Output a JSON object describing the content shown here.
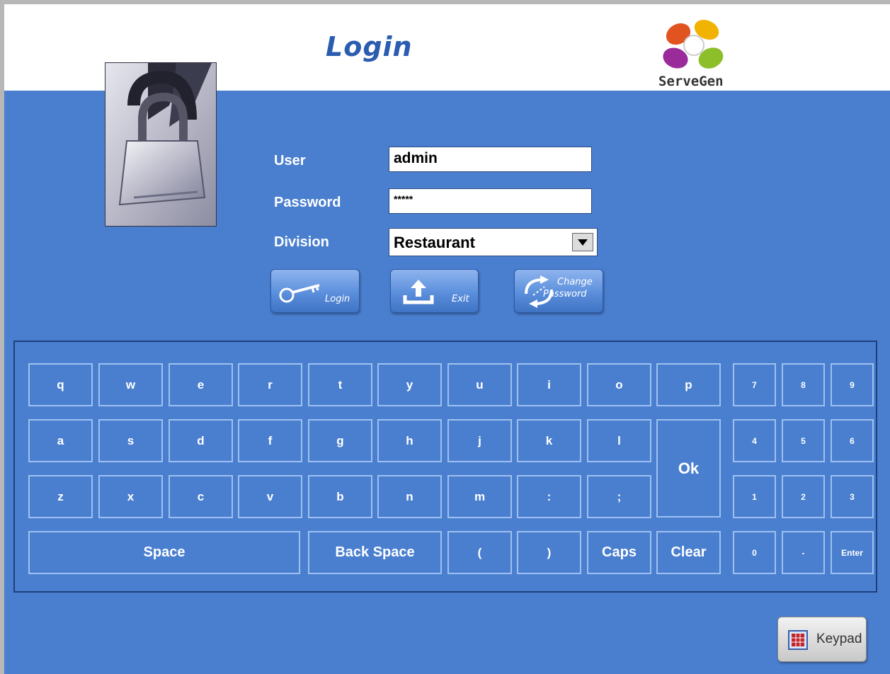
{
  "header": {
    "title": "Login",
    "logo_text": "ServeGen"
  },
  "form": {
    "user_label": "User",
    "user_value": "admin",
    "password_label": "Password",
    "password_value": "*****",
    "division_label": "Division",
    "division_value": "Restaurant"
  },
  "actions": {
    "login_label": "Login",
    "exit_label": "Exit",
    "change_password_line1": "Change",
    "change_password_line2": "Password"
  },
  "keyboard": {
    "row1": [
      "q",
      "w",
      "e",
      "r",
      "t",
      "y",
      "u",
      "i",
      "o",
      "p"
    ],
    "row2": [
      "a",
      "s",
      "d",
      "f",
      "g",
      "h",
      "j",
      "k",
      "l"
    ],
    "row3": [
      "z",
      "x",
      "c",
      "v",
      "b",
      "n",
      "m",
      ":",
      ";"
    ],
    "ok": "Ok",
    "space": "Space",
    "backspace": "Back Space",
    "open_paren": "(",
    "close_paren": ")",
    "caps": "Caps",
    "clear": "Clear",
    "numpad": [
      [
        "7",
        "8",
        "9"
      ],
      [
        "4",
        "5",
        "6"
      ],
      [
        "1",
        "2",
        "3"
      ],
      [
        "0",
        "-",
        "Enter"
      ]
    ]
  },
  "keypad_button_label": "Keypad",
  "colors": {
    "background": "#4a7fd0",
    "header": "#ffffff",
    "title": "#2a5cb0",
    "key_border": "#9ec0f0"
  }
}
